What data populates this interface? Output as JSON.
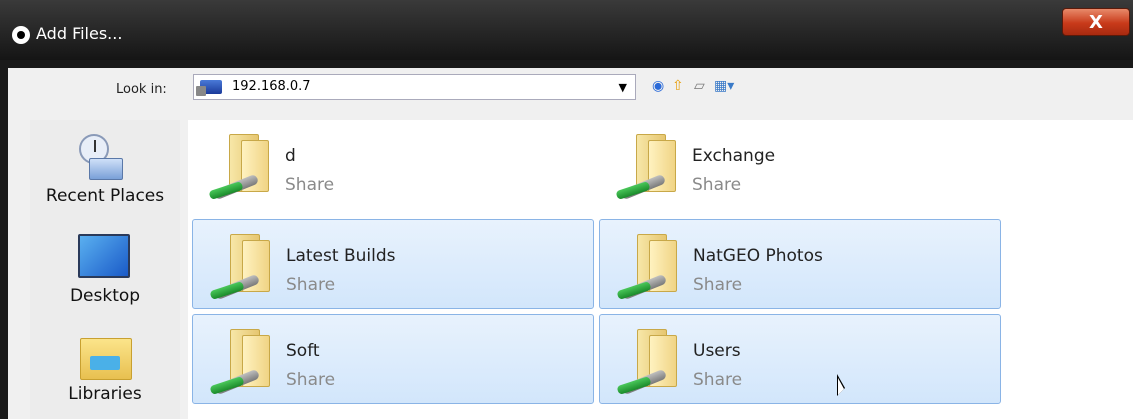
{
  "window": {
    "title": "Add Files...",
    "close_label": "X"
  },
  "lookin": {
    "label": "Look in:",
    "value": "192.168.0.7",
    "arrow": "▼"
  },
  "toolbar": {
    "back_icon": "back-icon",
    "up_icon": "up-folder-icon",
    "new_folder_icon": "new-folder-icon",
    "view_icon": "view-menu-icon"
  },
  "places": [
    {
      "label": "Recent Places",
      "icon": "recent-places-icon"
    },
    {
      "label": "Desktop",
      "icon": "desktop-icon"
    },
    {
      "label": "Libraries",
      "icon": "libraries-icon"
    }
  ],
  "items": [
    {
      "name": "d",
      "sub": "Share",
      "selected": false
    },
    {
      "name": "Exchange",
      "sub": "Share",
      "selected": false
    },
    {
      "name": "Latest Builds",
      "sub": "Share",
      "selected": true
    },
    {
      "name": "NatGEO Photos",
      "sub": "Share",
      "selected": true
    },
    {
      "name": "Soft",
      "sub": "Share",
      "selected": true
    },
    {
      "name": "Users",
      "sub": "Share",
      "selected": true
    }
  ],
  "colors": {
    "selection_fill": "#d2e6fb",
    "selection_border": "#8ab4e6",
    "close_red": "#c83a1a"
  }
}
